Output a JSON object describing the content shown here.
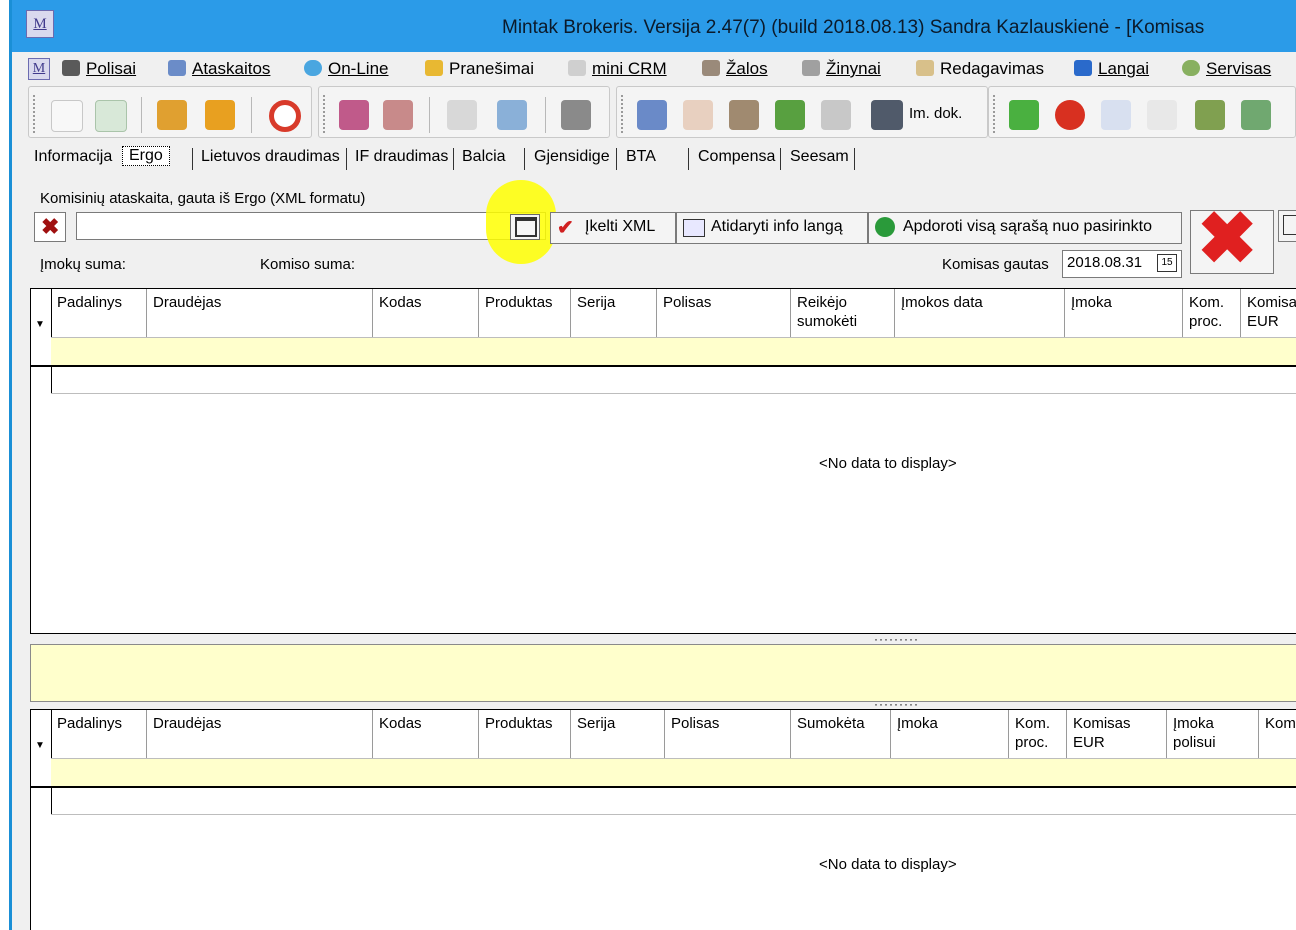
{
  "window": {
    "title": "Mintak Brokeris. Versija 2.47(7) (build 2018.08.13) Sandra Kazlauskienė - [Komisas",
    "icon": "M"
  },
  "menu": [
    {
      "label": "Polisai",
      "icon": "car-icon"
    },
    {
      "label": "Ataskaitos",
      "icon": "report-icon"
    },
    {
      "label": "On-Line",
      "icon": "globe-icon"
    },
    {
      "label": "Pranešimai",
      "icon": "notification-icon"
    },
    {
      "label": "mini CRM",
      "icon": "crm-icon"
    },
    {
      "label": "Žalos",
      "icon": "damage-icon"
    },
    {
      "label": "Žinynai",
      "icon": "dictionary-icon"
    },
    {
      "label": "Redagavimas",
      "icon": "edit-icon"
    },
    {
      "label": "Langai",
      "icon": "windows-icon"
    },
    {
      "label": "Servisas",
      "icon": "service-icon"
    }
  ],
  "toolbar": {
    "im_dok_label": "Im. dok."
  },
  "tabs": [
    "Informacija",
    "Ergo",
    "Lietuvos draudimas",
    "IF draudimas",
    "Balcia",
    "Gjensidige",
    "BTA",
    "Compensa",
    "Seesam"
  ],
  "active_tab": "Ergo",
  "panel": {
    "heading": "Komisinių ataskaita, gauta iš Ergo (XML formatu)",
    "file_input_value": "",
    "import_xml_label": "Įkelti XML",
    "open_info_label": "Atidaryti info langą",
    "process_all_label": "Apdoroti visą sąrašą nuo pasirinkto",
    "payments_sum_label": "Įmokų suma:",
    "commission_sum_label": "Komiso suma:",
    "commission_received_label": "Komisas gautas",
    "commission_received_date": "2018.08.31",
    "calendar_badge": "15"
  },
  "grid_top": {
    "columns": [
      "Padalinys",
      "Draudėjas",
      "Kodas",
      "Produktas",
      "Serija",
      "Polisas",
      "Reikėjo sumokėti",
      "Įmokos data",
      "Įmoka",
      "Kom. proc.",
      "Komisa EUR"
    ],
    "empty_text": "<No data to display>"
  },
  "grid_bottom": {
    "columns": [
      "Padalinys",
      "Draudėjas",
      "Kodas",
      "Produktas",
      "Serija",
      "Polisas",
      "Sumokėta",
      "Įmoka",
      "Kom. proc.",
      "Komisas EUR",
      "Įmoka polisui",
      "Kom polis"
    ],
    "empty_text": "<No data to display>"
  },
  "colors": {
    "titlebar": "#2b9be8",
    "filter_row": "#ffffcc",
    "highlight": "#ffff00",
    "delete_red": "#e02020"
  }
}
